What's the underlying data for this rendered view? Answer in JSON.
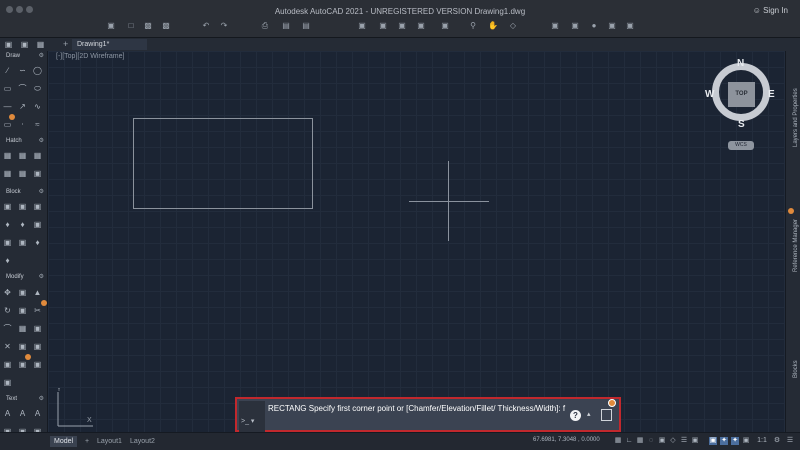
{
  "window": {
    "title": "Autodesk AutoCAD 2021 - UNREGISTERED VERSION    Drawing1.dwg",
    "sign_in": "Sign In"
  },
  "icons": {
    "toolbar": [
      "new-icon",
      "open-icon",
      "save-icon",
      "save-as-icon",
      "undo-icon",
      "redo-icon",
      "plot-icon",
      "publish-icon",
      "share-icon",
      "pan-icon",
      "orbit-icon"
    ],
    "accent_orange": "#e08a3c",
    "highlight_red": "#c1282d"
  },
  "tabs": {
    "document": "Drawing1*",
    "new_tab": "+"
  },
  "palette": {
    "draw": "Draw",
    "hatch": "Hatch",
    "block": "Block",
    "modify": "Modify",
    "text": "Text"
  },
  "viewport": {
    "label": "[-][Top][2D Wireframe]"
  },
  "viewcube": {
    "top": "TOP",
    "north": "N",
    "south": "S",
    "east": "E",
    "west": "W",
    "wcs": "WCS"
  },
  "right_panels": {
    "layers": "Layers and Properties",
    "reference": "Reference Manager",
    "blocks": "Blocks"
  },
  "command": {
    "text": "RECTANG Specify first corner point or [Chamfer/Elevation/Fillet/ Thickness/Width]: f",
    "prompt_glyph": ">_ ▾",
    "help": "?"
  },
  "status": {
    "model": "Model",
    "layout1": "Layout1",
    "layout2": "Layout2",
    "coordinates": "67.6981, 7.3048 , 0.0000",
    "scale": "1:1"
  }
}
